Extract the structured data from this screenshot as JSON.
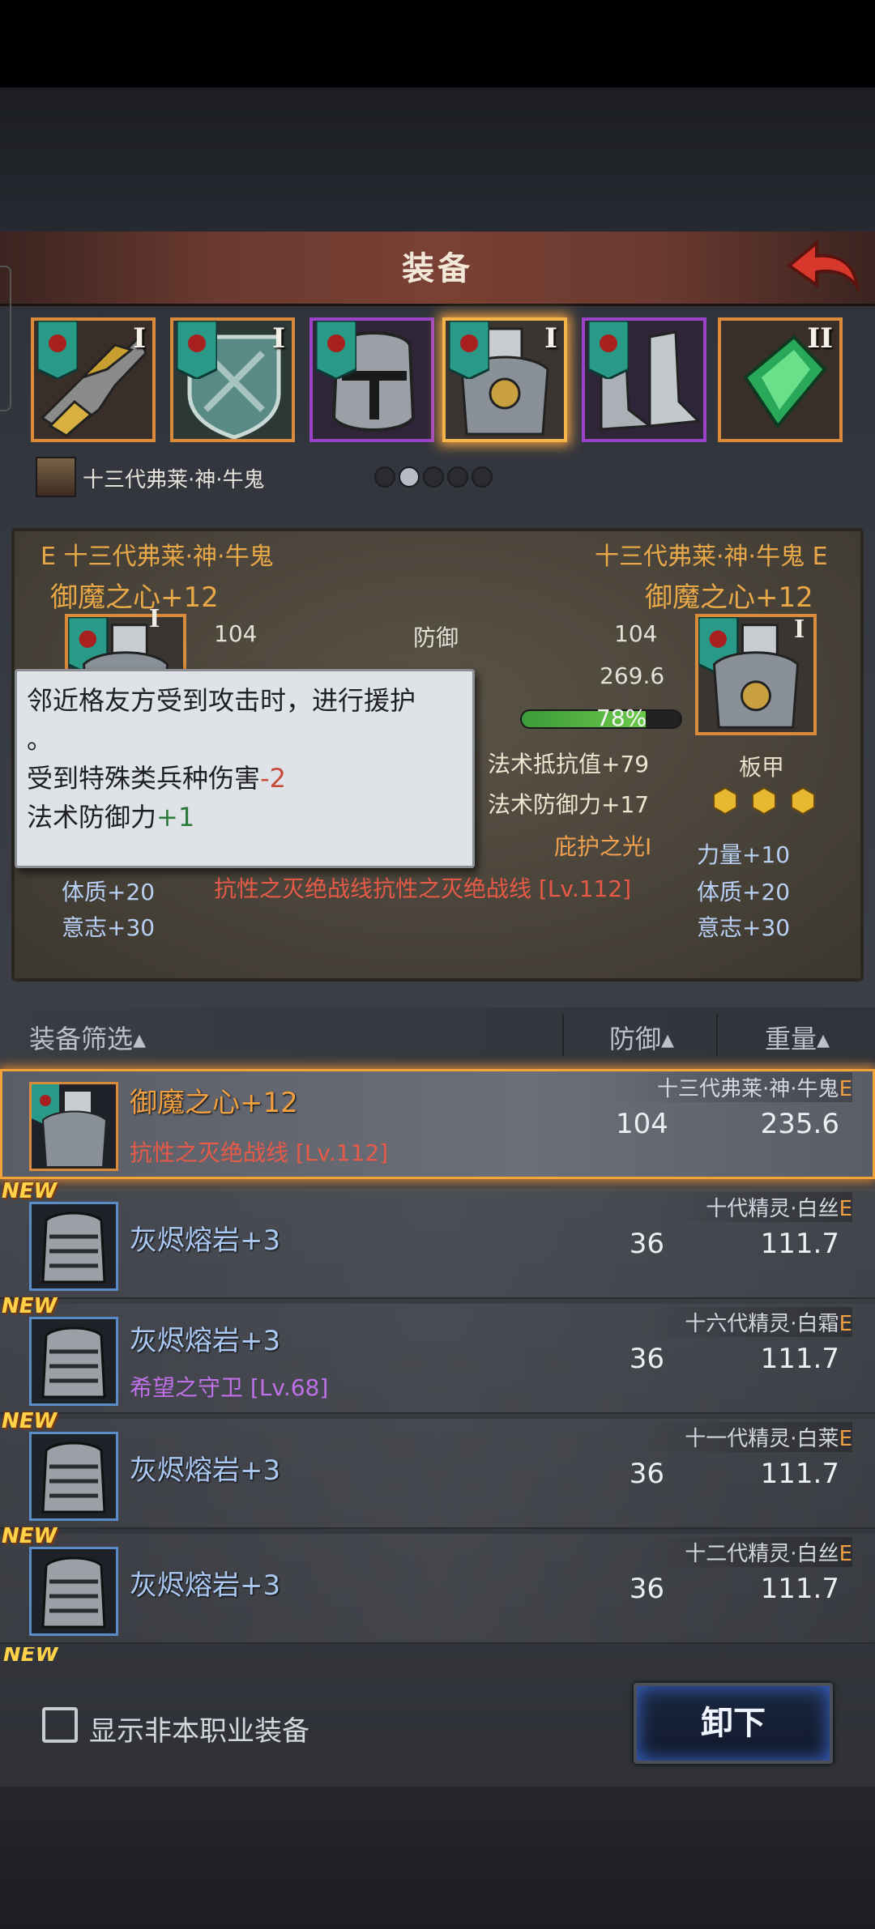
{
  "header": {
    "title": "装备",
    "back_icon": "back-arrow-icon"
  },
  "slots": [
    {
      "tier": "I",
      "icon": "gauntlet-icon",
      "rarity": "orange"
    },
    {
      "tier": "I",
      "icon": "shield-icon",
      "rarity": "orange"
    },
    {
      "tier": "",
      "icon": "helmet-icon",
      "rarity": "purple"
    },
    {
      "tier": "I",
      "icon": "plate-armor-icon",
      "rarity": "orange",
      "active": true
    },
    {
      "tier": "",
      "icon": "boots-icon",
      "rarity": "purple"
    },
    {
      "tier": "II",
      "icon": "crystal-accessory-icon",
      "rarity": "orange"
    }
  ],
  "character": {
    "name": "十三代弗莱·神·牛鬼"
  },
  "pager": {
    "count": 5,
    "active": 1
  },
  "compare": {
    "left": {
      "owner": "E 十三代弗莱·神·牛鬼",
      "item": "御魔之心+12",
      "tier": "I",
      "defense": "104",
      "weight": "269.6",
      "stat1": "体质+20",
      "stat2": "意志+30"
    },
    "right": {
      "owner": "十三代弗莱·神·牛鬼 E",
      "item": "御魔之心+12",
      "tier": "I",
      "type": "板甲",
      "stat0": "力量+10",
      "stat1": "体质+20",
      "stat2": "意志+30"
    },
    "middle": {
      "defense_value": "104",
      "defense_label": "防御",
      "weight_label": "重量",
      "weight_value": "269.6",
      "durability_pct": 78,
      "durability_label": "78%",
      "magic_resist_value": "法术抵抗值+79",
      "magic_defense": "法术防御力+17",
      "skill": "庇护之光I",
      "set_bonus": "抗性之灭绝战线抗性之灭绝战线 [Lv.112]"
    }
  },
  "tooltip": {
    "line1": "邻近格友方受到攻击时，进行援护",
    "line2": "。",
    "line3_label": "受到特殊类兵种伤害",
    "line3_value": "-2",
    "line4_label": "法术防御力",
    "line4_value": "+1"
  },
  "list_header": {
    "filter": "装备筛选▴",
    "defense": "防御▴",
    "weight": "重量▴"
  },
  "rows": [
    {
      "name": "御魔之心+12",
      "sub": "抗性之灭绝战线 [Lv.112]",
      "sub_color": "#e85a48",
      "owner": "十三代弗莱·神·牛鬼",
      "owner_grade": "E",
      "defense": "104",
      "weight": "235.6",
      "new": false,
      "selected": true,
      "icon": "plate-armor-icon"
    },
    {
      "name": "灰烬熔岩+3",
      "sub": "",
      "owner": "十代精灵·白丝",
      "owner_grade": "E",
      "defense": "36",
      "weight": "111.7",
      "new": true,
      "icon": "chest-armor-icon"
    },
    {
      "name": "灰烬熔岩+3",
      "sub": "希望之守卫 [Lv.68]",
      "sub_color": "#c070e8",
      "owner": "十六代精灵·白霜",
      "owner_grade": "E",
      "defense": "36",
      "weight": "111.7",
      "new": true,
      "icon": "chest-armor-icon"
    },
    {
      "name": "灰烬熔岩+3",
      "sub": "",
      "owner": "十一代精灵·白莱",
      "owner_grade": "E",
      "defense": "36",
      "weight": "111.7",
      "new": true,
      "icon": "chest-armor-icon"
    },
    {
      "name": "灰烬熔岩+3",
      "sub": "",
      "owner": "十二代精灵·白丝",
      "owner_grade": "E",
      "defense": "36",
      "weight": "111.7",
      "new": true,
      "icon": "chest-armor-icon"
    }
  ],
  "new_label": "NEW",
  "bottom": {
    "checkbox_label": "显示非本职业装备",
    "unload_label": "卸下"
  }
}
